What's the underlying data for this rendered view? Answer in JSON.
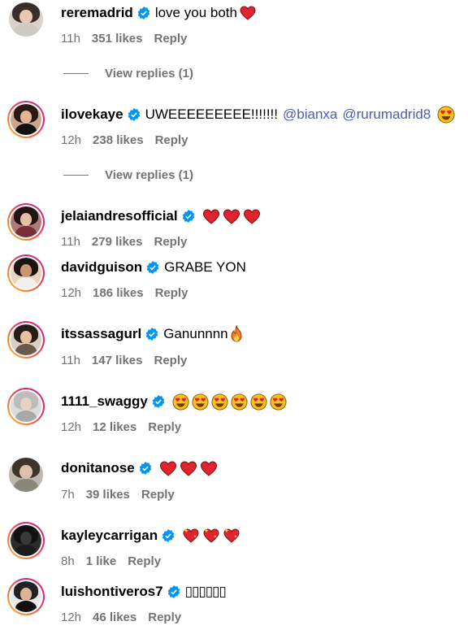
{
  "comments": [
    {
      "username": "reremadrid",
      "text": "love you both",
      "emoji_names": [
        "red-heart-icon"
      ],
      "time": "11h",
      "likes": "351 likes",
      "reply": "Reply",
      "view_replies": "View replies (1)"
    },
    {
      "username": "ilovekaye",
      "text": "UWEEEEEEEEE!!!!!!!",
      "mention1": "@bianxa",
      "mention2": "@rurumadrid8",
      "emoji_names": [
        "heart-eyes-icon"
      ],
      "time": "12h",
      "likes": "238 likes",
      "reply": "Reply",
      "view_replies": "View replies (1)"
    },
    {
      "username": "jelaiandresofficial",
      "text": "",
      "emoji_names": [
        "red-heart-icon",
        "red-heart-icon",
        "red-heart-icon"
      ],
      "time": "11h",
      "likes": "279 likes",
      "reply": "Reply"
    },
    {
      "username": "davidguison",
      "text": "GRABE YON",
      "emoji_names": [],
      "time": "12h",
      "likes": "186 likes",
      "reply": "Reply"
    },
    {
      "username": "itssassagurl",
      "text": "Ganunnnn",
      "emoji_names": [
        "fire-icon"
      ],
      "time": "11h",
      "likes": "147 likes",
      "reply": "Reply"
    },
    {
      "username": "1111_swaggy",
      "text": "",
      "emoji_names": [
        "heart-eyes-icon",
        "heart-eyes-icon",
        "heart-eyes-icon",
        "heart-eyes-icon",
        "heart-eyes-icon",
        "heart-eyes-icon"
      ],
      "time": "12h",
      "likes": "12 likes",
      "reply": "Reply"
    },
    {
      "username": "donitanose",
      "text": "",
      "emoji_names": [
        "red-heart-icon",
        "red-heart-icon",
        "red-heart-icon"
      ],
      "time": "7h",
      "likes": "39 likes",
      "reply": "Reply"
    },
    {
      "username": "kayleycarrigan",
      "text": "",
      "emoji_names": [
        "sparkling-heart-icon",
        "sparkling-heart-icon",
        "sparkling-heart-icon"
      ],
      "time": "8h",
      "likes": "1 like",
      "reply": "Reply"
    },
    {
      "username": "luishontiveros7",
      "text": "▯▯▯▯▯▯",
      "emoji_names": [],
      "time": "12h",
      "likes": "46 likes",
      "reply": "Reply"
    }
  ],
  "colors": {
    "verified": "#0095f6",
    "meta": "#737373",
    "mention": "#4a5db3",
    "heart": "#e0232e"
  }
}
